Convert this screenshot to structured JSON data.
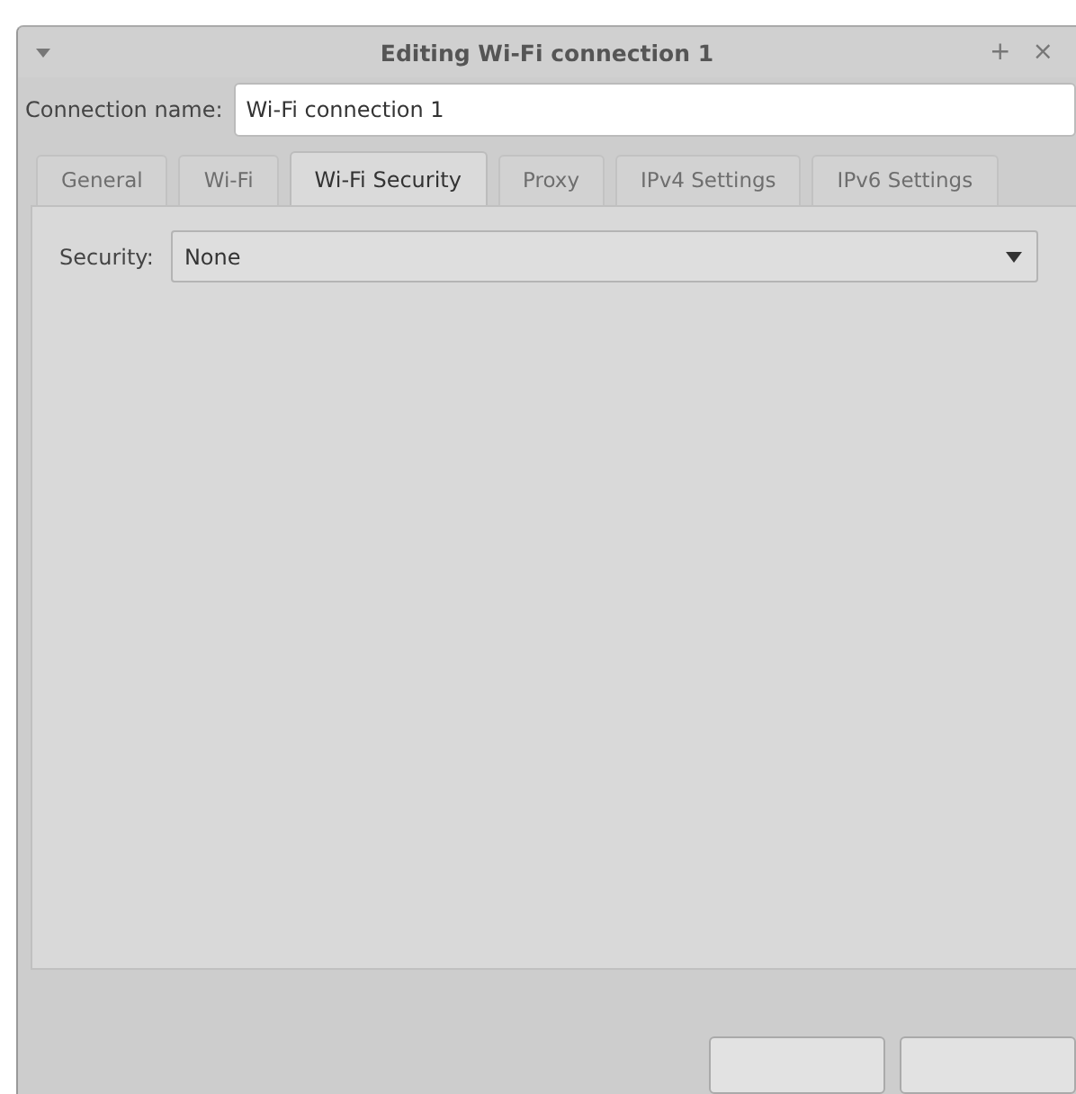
{
  "window": {
    "title": "Editing Wi-Fi connection 1",
    "controls": [
      "+",
      "×"
    ]
  },
  "connection_name": {
    "label": "Connection name:",
    "value": "Wi-Fi connection 1"
  },
  "tabs": [
    {
      "label": "General",
      "selected": false
    },
    {
      "label": "Wi-Fi",
      "selected": false
    },
    {
      "label": "Wi-Fi Security",
      "selected": true
    },
    {
      "label": "Proxy",
      "selected": false
    },
    {
      "label": "IPv4 Settings",
      "selected": false
    },
    {
      "label": "IPv6 Settings",
      "selected": false
    }
  ],
  "security": {
    "label": "Security:",
    "value": "None"
  }
}
